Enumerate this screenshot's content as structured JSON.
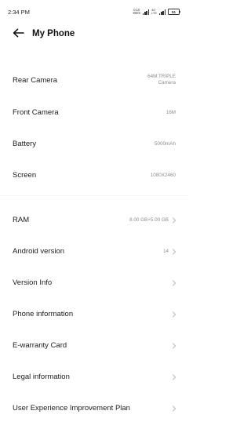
{
  "status_bar": {
    "time": "2:34 PM",
    "net_speed_value": "0.10",
    "net_speed_unit": "KB/S",
    "volte_top": "4G",
    "volte_bottom": "LTE",
    "battery_level": "51"
  },
  "header": {
    "title": "My Phone",
    "back_icon": "arrow-left-icon"
  },
  "specs": [
    {
      "label": "Rear Camera",
      "value_line1": "64M TRIPLE",
      "value_line2": "Camera"
    },
    {
      "label": "Front Camera",
      "value": "16M"
    },
    {
      "label": "Battery",
      "value": "5000mAh"
    },
    {
      "label": "Screen",
      "value": "1080X2460"
    }
  ],
  "menu": [
    {
      "label": "RAM",
      "value": "8.00 GB+5.00 GB"
    },
    {
      "label": "Android version",
      "value": "14"
    },
    {
      "label": "Version Info",
      "value": ""
    },
    {
      "label": "Phone information",
      "value": ""
    },
    {
      "label": "E-warranty Card",
      "value": ""
    },
    {
      "label": "Legal information",
      "value": ""
    },
    {
      "label": "User Experience Improvement Plan",
      "value": ""
    }
  ],
  "icons": {
    "chevron": "chevron-right-icon",
    "signal": "signal-icon",
    "battery": "battery-icon"
  }
}
